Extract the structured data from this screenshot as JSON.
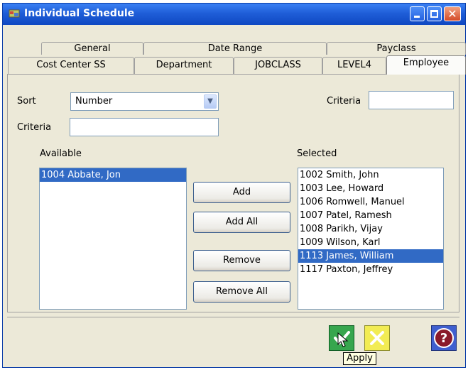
{
  "window": {
    "title": "Individual Schedule"
  },
  "tabs_back": [
    "General",
    "Date Range",
    "Payclass"
  ],
  "tabs_front": [
    "Cost Center SS",
    "Department",
    "JOBCLASS",
    "LEVEL4",
    "Employee"
  ],
  "active_tab": "Employee",
  "sort": {
    "label": "Sort",
    "value": "Number"
  },
  "criteria": {
    "label": "Criteria",
    "value": ""
  },
  "criteria2": {
    "label": "Criteria",
    "value": ""
  },
  "available": {
    "label": "Available",
    "items": [
      "1004 Abbate, Jon"
    ],
    "selected_index": 0
  },
  "selected": {
    "label": "Selected",
    "items": [
      "1002 Smith, John",
      "1003 Lee, Howard",
      "1006 Romwell, Manuel",
      "1007 Patel, Ramesh",
      "1008 Parikh, Vijay",
      "1009 Wilson, Karl",
      "1113 James, William",
      "1117 Paxton, Jeffrey"
    ],
    "selected_index": 6
  },
  "buttons": {
    "add": "Add",
    "add_all": "Add All",
    "remove": "Remove",
    "remove_all": "Remove All"
  },
  "footer": {
    "tooltip": "Apply",
    "help_glyph": "?"
  },
  "icons": {
    "minimize": "minimize-icon",
    "maximize": "maximize-icon",
    "close": "close-icon",
    "dropdown": "chevron-down-icon",
    "apply": "checkmark-icon",
    "cancel": "x-icon",
    "help": "question-icon"
  },
  "colors": {
    "titlebar": "#1f5ed8",
    "selection": "#316ac5",
    "apply": "#37a64e",
    "cancel": "#f2ec54",
    "help": "#3f5fcf"
  }
}
